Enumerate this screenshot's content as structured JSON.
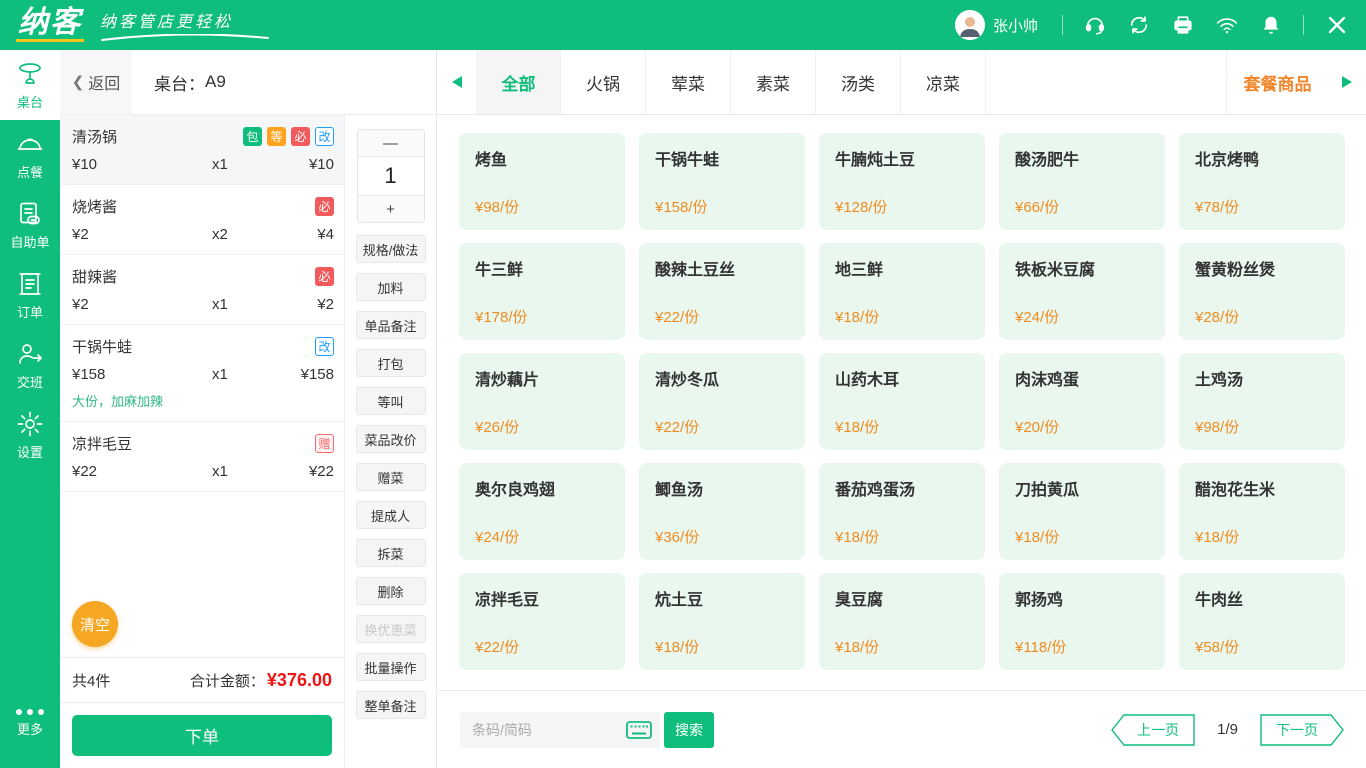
{
  "topbar": {
    "logo_text": "纳客",
    "slogan": "纳客管店更轻松",
    "user_name": "张小帅",
    "icons": [
      "headset-icon",
      "sync-icon",
      "printer-icon",
      "wifi-icon",
      "bell-icon"
    ]
  },
  "sidebar": {
    "items": [
      {
        "label": "桌台",
        "icon": "table-icon",
        "active": true
      },
      {
        "label": "点餐",
        "icon": "cloche-icon",
        "active": false
      },
      {
        "label": "自助单",
        "icon": "self-order-icon",
        "active": false
      },
      {
        "label": "订单",
        "icon": "order-list-icon",
        "active": false
      },
      {
        "label": "交班",
        "icon": "shift-icon",
        "active": false
      },
      {
        "label": "设置",
        "icon": "gear-icon",
        "active": false
      }
    ],
    "more_label": "更多"
  },
  "order_panel": {
    "back_label": "返回",
    "table_label": "桌台：",
    "table_value": "A9",
    "items": [
      {
        "name": "清汤锅",
        "badges": [
          "包",
          "等",
          "必",
          "改"
        ],
        "price": "¥10",
        "qty": "x1",
        "total": "¥10",
        "selected": true
      },
      {
        "name": "烧烤酱",
        "badges": [
          "必"
        ],
        "price": "¥2",
        "qty": "x2",
        "total": "¥4",
        "selected": false
      },
      {
        "name": "甜辣酱",
        "badges": [
          "必"
        ],
        "price": "¥2",
        "qty": "x1",
        "total": "¥2",
        "selected": false
      },
      {
        "name": "干锅牛蛙",
        "badges": [
          "改"
        ],
        "price": "¥158",
        "qty": "x1",
        "total": "¥158",
        "note": "大份，加麻加辣",
        "selected": false
      },
      {
        "name": "凉拌毛豆",
        "badges": [
          "赠"
        ],
        "price": "¥22",
        "qty": "x1",
        "total": "¥22",
        "selected": false
      }
    ],
    "clear_label": "清空",
    "count_label": "共4件",
    "total_label": "合计金额：",
    "total_value": "¥376.00",
    "submit_label": "下单"
  },
  "actions": {
    "stepper": {
      "minus": "—",
      "value": "1",
      "plus": "+"
    },
    "buttons": [
      {
        "label": "规格/做法",
        "disabled": false
      },
      {
        "label": "加料",
        "disabled": false
      },
      {
        "label": "单品备注",
        "disabled": false
      },
      {
        "label": "打包",
        "disabled": false
      },
      {
        "label": "等叫",
        "disabled": false
      },
      {
        "label": "菜品改价",
        "disabled": false
      },
      {
        "label": "赠菜",
        "disabled": false
      },
      {
        "label": "提成人",
        "disabled": false
      },
      {
        "label": "拆菜",
        "disabled": false
      },
      {
        "label": "删除",
        "disabled": false
      },
      {
        "label": "换优惠菜",
        "disabled": true
      },
      {
        "label": "批量操作",
        "disabled": false
      },
      {
        "label": "整单备注",
        "disabled": false
      }
    ]
  },
  "categories": {
    "tabs": [
      {
        "label": "全部",
        "active": true
      },
      {
        "label": "火锅",
        "active": false
      },
      {
        "label": "荤菜",
        "active": false
      },
      {
        "label": "素菜",
        "active": false
      },
      {
        "label": "汤类",
        "active": false
      },
      {
        "label": "凉菜",
        "active": false
      }
    ],
    "special_tab": "套餐商品"
  },
  "menu": {
    "items": [
      {
        "name": "烤鱼",
        "price": "¥98/份"
      },
      {
        "name": "干锅牛蛙",
        "price": "¥158/份"
      },
      {
        "name": "牛腩炖土豆",
        "price": "¥128/份"
      },
      {
        "name": "酸汤肥牛",
        "price": "¥66/份"
      },
      {
        "name": "北京烤鸭",
        "price": "¥78/份"
      },
      {
        "name": "牛三鲜",
        "price": "¥178/份"
      },
      {
        "name": "酸辣土豆丝",
        "price": "¥22/份"
      },
      {
        "name": "地三鲜",
        "price": "¥18/份"
      },
      {
        "name": "铁板米豆腐",
        "price": "¥24/份"
      },
      {
        "name": "蟹黄粉丝煲",
        "price": "¥28/份"
      },
      {
        "name": "清炒藕片",
        "price": "¥26/份"
      },
      {
        "name": "清炒冬瓜",
        "price": "¥22/份"
      },
      {
        "name": "山药木耳",
        "price": "¥18/份"
      },
      {
        "name": "肉沫鸡蛋",
        "price": "¥20/份"
      },
      {
        "name": "土鸡汤",
        "price": "¥98/份"
      },
      {
        "name": "奥尔良鸡翅",
        "price": "¥24/份"
      },
      {
        "name": "鲫鱼汤",
        "price": "¥36/份"
      },
      {
        "name": "番茄鸡蛋汤",
        "price": "¥18/份"
      },
      {
        "name": "刀拍黄瓜",
        "price": "¥18/份"
      },
      {
        "name": "醋泡花生米",
        "price": "¥18/份"
      },
      {
        "name": "凉拌毛豆",
        "price": "¥22/份"
      },
      {
        "name": "炕土豆",
        "price": "¥18/份"
      },
      {
        "name": "臭豆腐",
        "price": "¥18/份"
      },
      {
        "name": "郭扬鸡",
        "price": "¥118/份"
      },
      {
        "name": "牛肉丝",
        "price": "¥58/份"
      }
    ]
  },
  "search": {
    "placeholder": "条码/简码",
    "button_label": "搜索"
  },
  "pagination": {
    "prev": "上一页",
    "page": "1/9",
    "next": "下一页"
  },
  "colors": {
    "brand_green": "#0FBE7C",
    "price_orange": "#F08C1F",
    "special_tab_orange": "#F0862A",
    "clear_orange": "#F5A623",
    "total_red": "#F01414",
    "badge_orange": "#FFA21D",
    "badge_red": "#F25B5B",
    "badge_blue": "#1E9FFF",
    "card_bg": "#E9F7EF"
  }
}
